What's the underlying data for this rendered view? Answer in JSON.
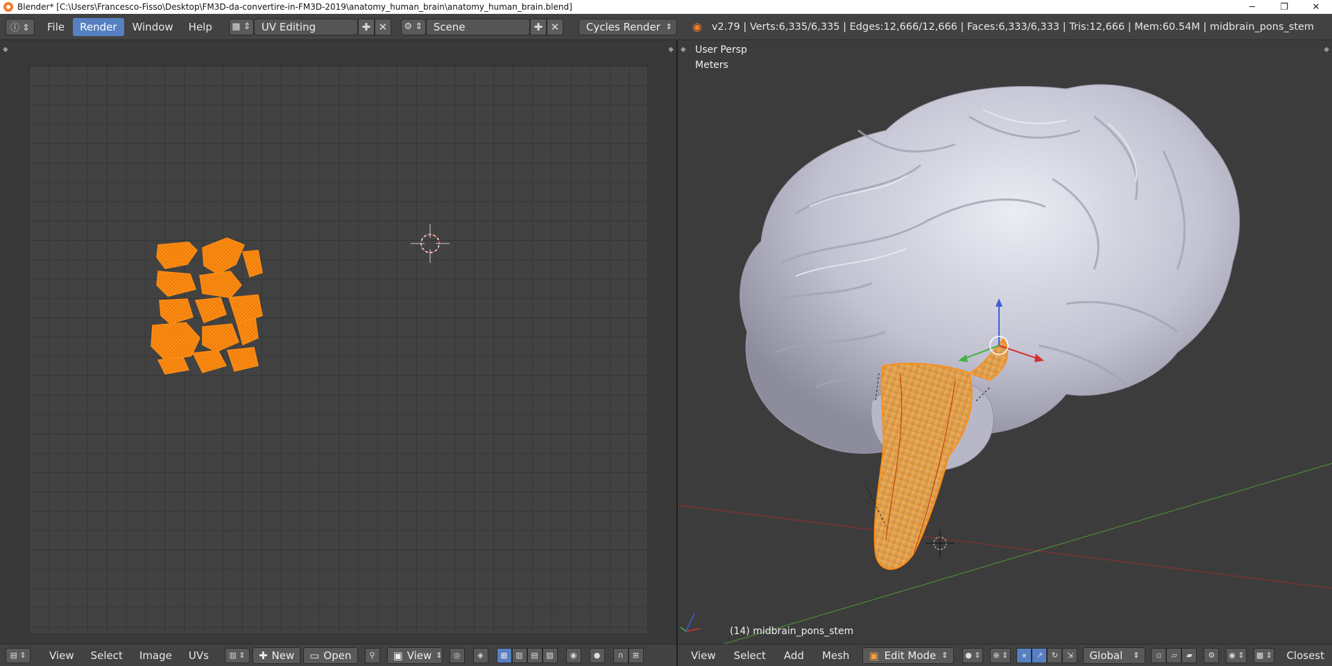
{
  "window": {
    "title": "Blender* [C:\\Users\\Francesco-Fisso\\Desktop\\FM3D-da-convertire-in-FM3D-2019\\anatomy_human_brain\\anatomy_human_brain.blend]",
    "minimize": "─",
    "maximize": "❐",
    "close": "✕"
  },
  "info_header": {
    "menus": [
      "File",
      "Render",
      "Window",
      "Help"
    ],
    "active_menu": "Render",
    "screen_layout": "UV Editing",
    "scene": "Scene",
    "render_engine": "Cycles Render",
    "stats": "v2.79 | Verts:6,335/6,335 | Edges:12,666/12,666 | Faces:6,333/6,333 | Tris:12,666 | Mem:60.54M | midbrain_pons_stem"
  },
  "viewport": {
    "view_name": "User Persp",
    "units": "Meters",
    "object_label": "(14) midbrain_pons_stem"
  },
  "uv_footer": {
    "menus": [
      "View",
      "Select",
      "Image",
      "UVs"
    ],
    "new_label": "New",
    "open_label": "Open",
    "view_label": "View"
  },
  "vp_footer": {
    "menus": [
      "View",
      "Select",
      "Add",
      "Mesh"
    ],
    "mode": "Edit Mode",
    "orientation": "Global",
    "snap": "Closest"
  },
  "colors": {
    "accent": "#5680c2",
    "selection": "#ff8c12",
    "mesh": "#c8c8d6"
  }
}
